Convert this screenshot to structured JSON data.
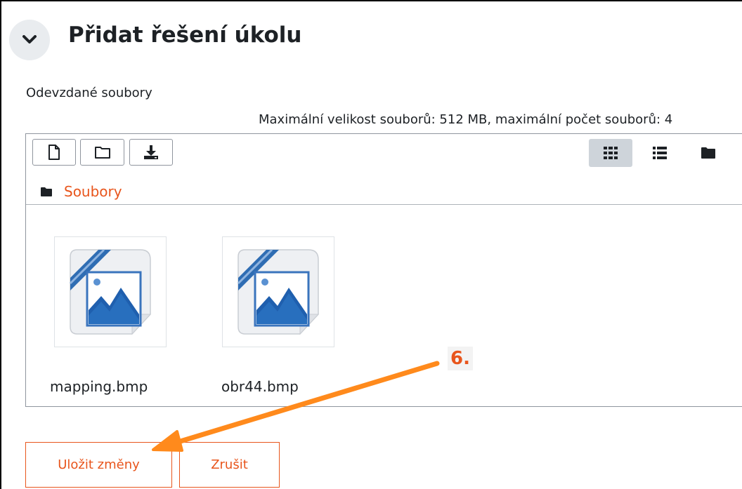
{
  "section": {
    "title": "Přidat řešení úkolu",
    "collapse_icon": "chevron-down-icon"
  },
  "field": {
    "label": "Odevzdané soubory",
    "limits": "Maximální velikost souborů: 512 MB, maximální počet souborů: 4"
  },
  "filemanager": {
    "toolbar": {
      "left_icons": [
        "new-file-icon",
        "new-folder-icon",
        "download-icon"
      ],
      "view_icons": [
        "grid-view-icon",
        "list-view-icon",
        "folder-view-icon"
      ],
      "active_view": "grid-view-icon"
    },
    "path": {
      "icon": "folder-icon",
      "label": "Soubory"
    },
    "files": [
      {
        "name": "mapping.bmp",
        "icon": "image-file-icon"
      },
      {
        "name": "obr44.bmp",
        "icon": "image-file-icon"
      }
    ]
  },
  "actions": {
    "save_label": "Uložit změny",
    "cancel_label": "Zrušit"
  },
  "annotation": {
    "label": "6.",
    "color": "#ff8a1c"
  },
  "colors": {
    "accent": "#e8551c",
    "text": "#1d2125",
    "active_view_bg": "#ced4da"
  }
}
